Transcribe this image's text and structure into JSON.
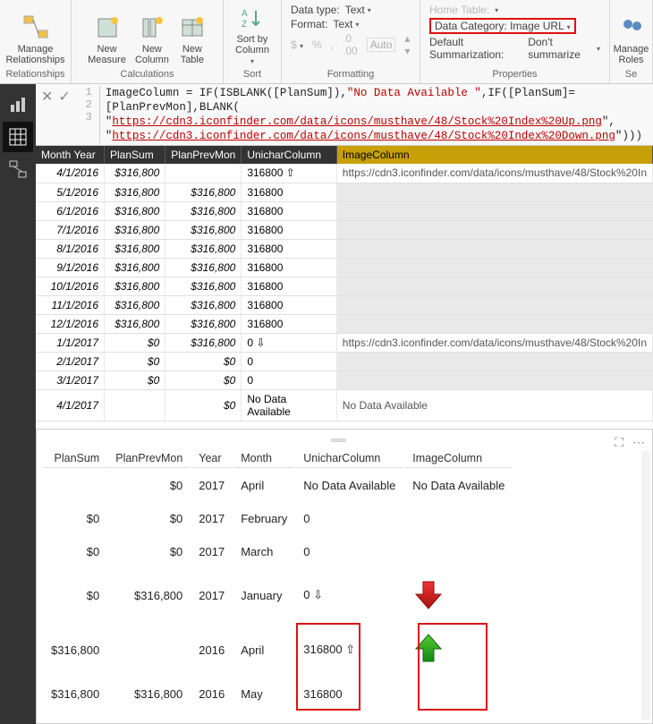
{
  "ribbon": {
    "relationships": {
      "manage_label": "Manage\nRelationships",
      "group": "Relationships"
    },
    "calculations": {
      "new_measure": "New\nMeasure",
      "new_column": "New\nColumn",
      "new_table": "New\nTable",
      "group": "Calculations"
    },
    "sort": {
      "sort_by": "Sort by\nColumn",
      "group": "Sort"
    },
    "formatting": {
      "datatype_label": "Data type:",
      "datatype_value": "Text",
      "format_label": "Format:",
      "format_value": "Text",
      "auto": "Auto",
      "group": "Formatting"
    },
    "properties": {
      "hometable_label": "Home Table:",
      "category_label": "Data Category:",
      "category_value": "Image URL",
      "summarization_label": "Default Summarization:",
      "summarization_value": "Don't summarize",
      "group": "Properties"
    },
    "security": {
      "manage_roles": "Manage\nRoles",
      "group": "Se"
    }
  },
  "formula": {
    "column": "ImageColumn",
    "line1_a": " = IF(ISBLANK([PlanSum]),",
    "line1_b": "\"No Data Available \"",
    "line1_c": ",IF([PlanSum]=[PlanPrevMon],BLANK(",
    "line2_url": "https://cdn3.iconfinder.com/data/icons/musthave/48/Stock%20Index%20Up.png",
    "line3_url": "https://cdn3.iconfinder.com/data/icons/musthave/48/Stock%20Index%20Down.png",
    "line3_tail": ")))"
  },
  "grid": {
    "headers": {
      "monthyear": "Month Year",
      "plansum": "PlanSum",
      "planprev": "PlanPrevMon",
      "unichar": "UnicharColumn",
      "imagecol": "ImageColumn"
    },
    "rows": [
      {
        "my": "4/1/2016",
        "ps": "$316,800",
        "pp": "",
        "uc": "316800 ⇧",
        "img": "https://cdn3.iconfinder.com/data/icons/musthave/48/Stock%20In"
      },
      {
        "my": "5/1/2016",
        "ps": "$316,800",
        "pp": "$316,800",
        "uc": "316800",
        "img": ""
      },
      {
        "my": "6/1/2016",
        "ps": "$316,800",
        "pp": "$316,800",
        "uc": "316800",
        "img": ""
      },
      {
        "my": "7/1/2016",
        "ps": "$316,800",
        "pp": "$316,800",
        "uc": "316800",
        "img": ""
      },
      {
        "my": "8/1/2016",
        "ps": "$316,800",
        "pp": "$316,800",
        "uc": "316800",
        "img": ""
      },
      {
        "my": "9/1/2016",
        "ps": "$316,800",
        "pp": "$316,800",
        "uc": "316800",
        "img": ""
      },
      {
        "my": "10/1/2016",
        "ps": "$316,800",
        "pp": "$316,800",
        "uc": "316800",
        "img": ""
      },
      {
        "my": "11/1/2016",
        "ps": "$316,800",
        "pp": "$316,800",
        "uc": "316800",
        "img": ""
      },
      {
        "my": "12/1/2016",
        "ps": "$316,800",
        "pp": "$316,800",
        "uc": "316800",
        "img": ""
      },
      {
        "my": "1/1/2017",
        "ps": "$0",
        "pp": "$316,800",
        "uc": "0 ⇩",
        "img": "https://cdn3.iconfinder.com/data/icons/musthave/48/Stock%20In"
      },
      {
        "my": "2/1/2017",
        "ps": "$0",
        "pp": "$0",
        "uc": "0",
        "img": ""
      },
      {
        "my": "3/1/2017",
        "ps": "$0",
        "pp": "$0",
        "uc": "0",
        "img": ""
      },
      {
        "my": "4/1/2017",
        "ps": "",
        "pp": "$0",
        "uc": "No Data Available",
        "img": "No Data Available"
      }
    ]
  },
  "visual": {
    "headers": {
      "plansum": "PlanSum",
      "planprev": "PlanPrevMon",
      "year": "Year",
      "month": "Month",
      "unichar": "UnicharColumn",
      "imagecol": "ImageColumn"
    },
    "rows": [
      {
        "ps": "",
        "pp": "$0",
        "yr": "2017",
        "mo": "April",
        "uc": "No Data Available",
        "img": "No Data Available",
        "arrow": ""
      },
      {
        "ps": "$0",
        "pp": "$0",
        "yr": "2017",
        "mo": "February",
        "uc": "0",
        "img": "",
        "arrow": ""
      },
      {
        "ps": "$0",
        "pp": "$0",
        "yr": "2017",
        "mo": "March",
        "uc": "0",
        "img": "",
        "arrow": ""
      },
      {
        "ps": "$0",
        "pp": "$316,800",
        "yr": "2017",
        "mo": "January",
        "uc": "0 ⇩",
        "img": "",
        "arrow": "down"
      },
      {
        "ps": "$316,800",
        "pp": "",
        "yr": "2016",
        "mo": "April",
        "uc": "316800 ⇧",
        "img": "",
        "arrow": "up"
      },
      {
        "ps": "$316,800",
        "pp": "$316,800",
        "yr": "2016",
        "mo": "May",
        "uc": "316800",
        "img": "",
        "arrow": ""
      }
    ]
  }
}
